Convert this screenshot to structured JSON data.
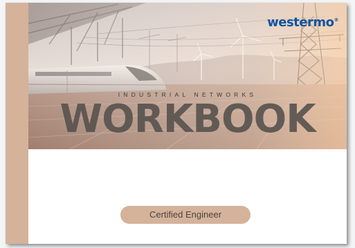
{
  "cover": {
    "logo": "westermo",
    "logo_mark": "®",
    "subtitle": "INDUSTRIAL NETWORKS",
    "title": "WORKBOOK",
    "badge": "Certified Engineer"
  },
  "colors": {
    "spine": "#d5b29a",
    "badge": "#d5b29a",
    "logo": "#0d56a3",
    "title": "#57524e"
  }
}
